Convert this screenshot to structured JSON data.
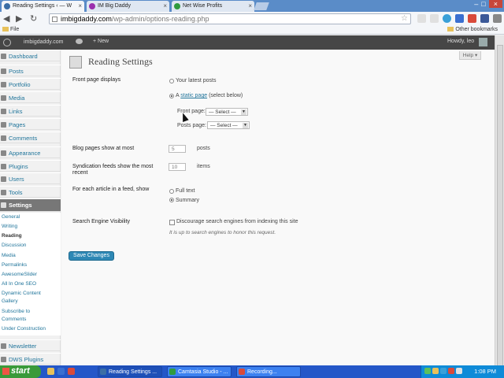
{
  "browser": {
    "tabs": [
      {
        "label": "Reading Settings ‹ — W",
        "fav_color": "#3b6ea5"
      },
      {
        "label": "IM Big Daddy",
        "fav_color": "#9b2fae"
      },
      {
        "label": "Net Wise Profits",
        "fav_color": "#2f9b3f"
      }
    ],
    "url_domain": "imbigdaddy.com",
    "url_path": "/wp-admin/options-reading.php",
    "bookmarks": {
      "file_label": "File",
      "other_label": "Other bookmarks"
    }
  },
  "admin_bar": {
    "site_name": "imbigdaddy.com",
    "new_label": "+ New",
    "howdy": "Howdy, leo"
  },
  "sidebar": {
    "items": [
      {
        "label": "Dashboard",
        "name": "dashboard"
      },
      {
        "label": "Posts",
        "name": "posts"
      },
      {
        "label": "Portfolio",
        "name": "portfolio"
      },
      {
        "label": "Media",
        "name": "media"
      },
      {
        "label": "Links",
        "name": "links"
      },
      {
        "label": "Pages",
        "name": "pages"
      },
      {
        "label": "Comments",
        "name": "comments"
      },
      {
        "label": "Appearance",
        "name": "appearance"
      },
      {
        "label": "Plugins",
        "name": "plugins"
      },
      {
        "label": "Users",
        "name": "users"
      },
      {
        "label": "Tools",
        "name": "tools"
      },
      {
        "label": "Settings",
        "name": "settings"
      }
    ],
    "submenu": [
      {
        "label": "General"
      },
      {
        "label": "Writing"
      },
      {
        "label": "Reading"
      },
      {
        "label": "Discussion"
      },
      {
        "label": "Media"
      },
      {
        "label": "Permalinks"
      },
      {
        "label": "AwesomeSlider"
      },
      {
        "label": "All In One SEO"
      },
      {
        "label": "Dynamic Content"
      },
      {
        "label": "Gallery"
      },
      {
        "label": "Subscribe to"
      },
      {
        "label": "Comments"
      },
      {
        "label": "Under Construction"
      }
    ],
    "bottom_items": [
      {
        "label": "Newsletter"
      },
      {
        "label": "DWS Plugins"
      }
    ]
  },
  "main": {
    "help_label": "Help ▾",
    "page_title": "Reading Settings",
    "front_page": {
      "label": "Front page displays",
      "option_latest": "Your latest posts",
      "option_static_prefix": "A",
      "option_static_link": "static page",
      "option_static_suffix": "(select below)",
      "front_page_label": "Front page:",
      "front_page_value": "— Select —",
      "posts_page_label": "Posts page:",
      "posts_page_value": "— Select —"
    },
    "blog_pages": {
      "label": "Blog pages show at most",
      "value": "5",
      "unit": "posts"
    },
    "syndication": {
      "label_line1": "Syndication feeds show the most",
      "label_line2": "recent",
      "value": "10",
      "unit": "items"
    },
    "feed_article": {
      "label": "For each article in a feed, show",
      "option_full": "Full text",
      "option_summary": "Summary"
    },
    "search_engine": {
      "label": "Search Engine Visibility",
      "checkbox_label": "Discourage search engines from indexing this site",
      "description": "It is up to search engines to honor this request."
    },
    "save_label": "Save Changes"
  },
  "taskbar": {
    "start_label": "start",
    "tasks": [
      {
        "label": "Reading Settings ...",
        "icon_color": "#3b6ea5"
      },
      {
        "label": "Camtasia Studio - ...",
        "icon_color": "#2f9b3f"
      },
      {
        "label": "Recording...",
        "icon_color": "#d94a3a"
      }
    ],
    "clock": "1:08 PM"
  }
}
